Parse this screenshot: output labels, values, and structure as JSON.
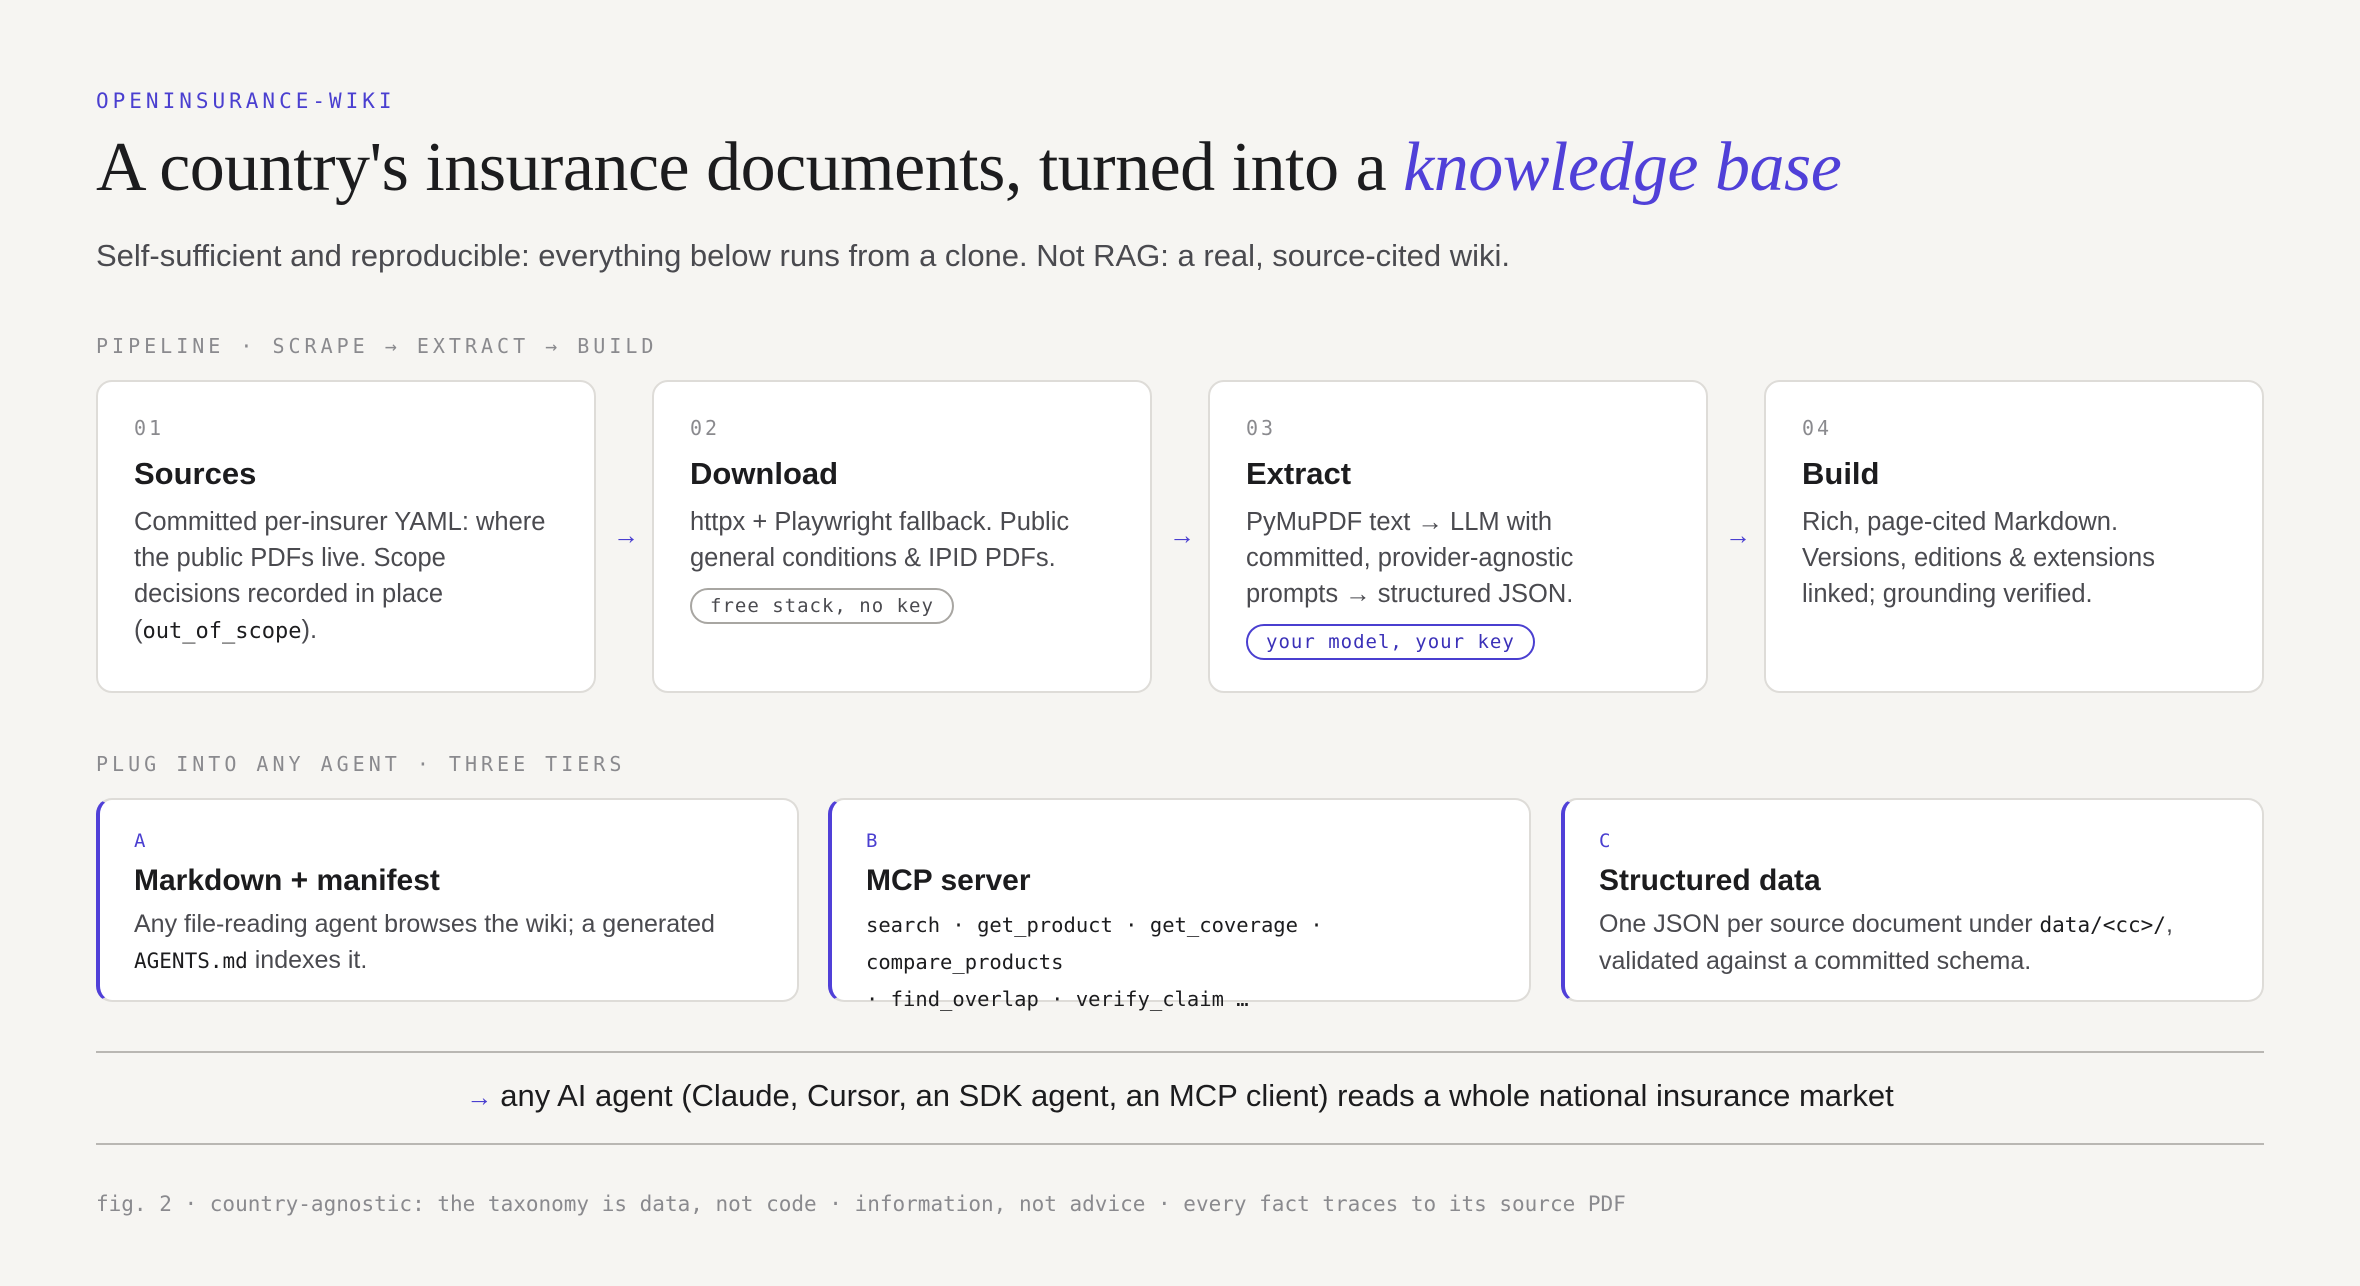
{
  "eyebrow": "OPENINSURANCE-WIKI",
  "headline": {
    "main": "A country's insurance documents, turned into a ",
    "accent": "knowledge base"
  },
  "subtitle": "Self-sufficient and reproducible: everything below runs from a clone. Not RAG: a real, source-cited wiki.",
  "pipeline": {
    "label": "PIPELINE · SCRAPE → EXTRACT → BUILD",
    "arrow": "→",
    "steps": [
      {
        "num": "01",
        "title": "Sources",
        "desc": "Committed per-insurer YAML: where the public PDFs live. Scope decisions recorded in place (",
        "code": "out_of_scope",
        "desc_tail": ")."
      },
      {
        "num": "02",
        "title": "Download",
        "desc": "httpx + Playwright fallback. Public general conditions & IPID PDFs.",
        "pill": "free stack, no key"
      },
      {
        "num": "03",
        "title": "Extract",
        "desc": "PyMuPDF text → LLM with committed, provider-agnostic prompts → structured JSON.",
        "pill": "your model, your key"
      },
      {
        "num": "04",
        "title": "Build",
        "desc": "Rich, page-cited Markdown. Versions, editions & extensions linked; grounding verified."
      }
    ]
  },
  "tiers": {
    "label": "PLUG INTO ANY AGENT · THREE TIERS",
    "items": [
      {
        "letter": "A",
        "title": "Markdown + manifest",
        "desc_pre": "Any file-reading agent browses the wiki; a generated ",
        "code": "AGENTS.md",
        "desc_post": " indexes it."
      },
      {
        "letter": "B",
        "title": "MCP server",
        "tools_line1": "search · get_product · get_coverage · compare_products",
        "tools_line2": "· find_overlap · verify_claim …"
      },
      {
        "letter": "C",
        "title": "Structured data",
        "desc_pre": "One JSON per source document under ",
        "code": "data/<cc>/",
        "desc_post": ",",
        "desc_line2": "validated against a committed schema."
      }
    ]
  },
  "conclusion": {
    "arrow": "→",
    "text": "any AI agent (Claude, Cursor, an SDK agent, an MCP client) reads a whole national insurance market"
  },
  "footnote": "fig. 2 · country-agnostic: the taxonomy is data, not code · information, not advice · every fact traces to its source PDF",
  "colors": {
    "accent": "#5040d8",
    "background": "#f6f5f2",
    "card": "#ffffff",
    "muted": "#8a8a8e"
  }
}
